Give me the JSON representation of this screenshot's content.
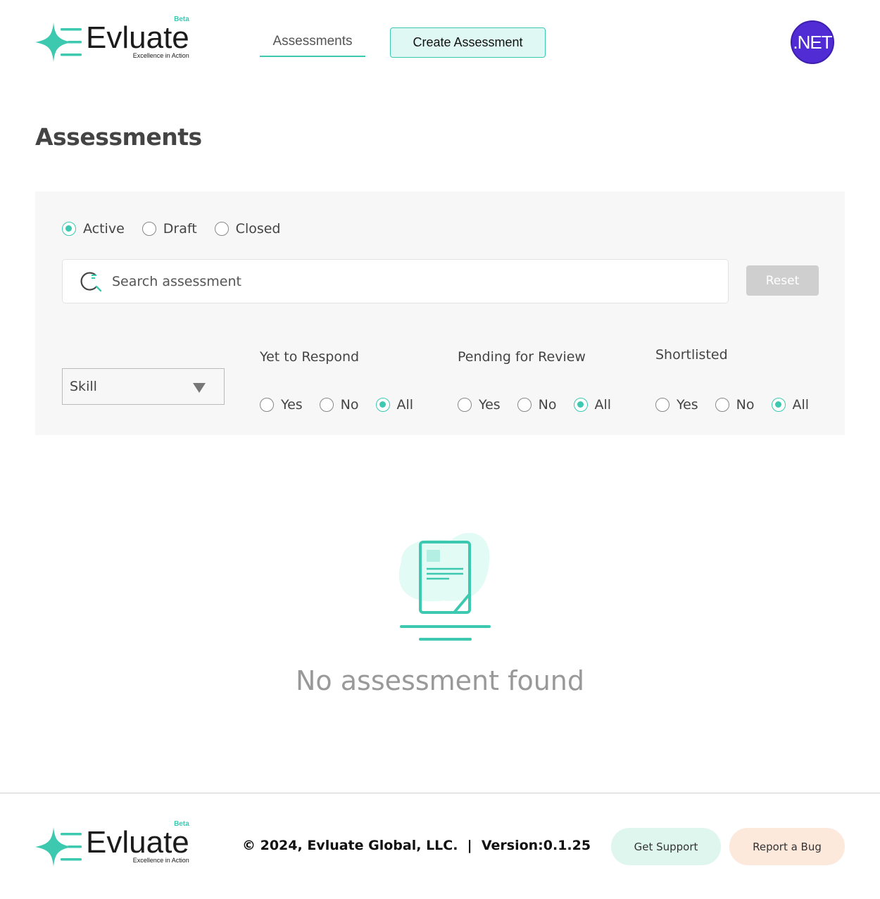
{
  "brand": {
    "name": "Evluate",
    "beta": "Beta",
    "tagline": "Excellence in Action",
    "accent_color": "#3cc9b0"
  },
  "header": {
    "nav_assessments": "Assessments",
    "create_assessment": "Create Assessment",
    "avatar_text": ".NET",
    "avatar_color": "#512bd4"
  },
  "page": {
    "title": "Assessments"
  },
  "filters": {
    "status": [
      {
        "label": "Active",
        "selected": true
      },
      {
        "label": "Draft",
        "selected": false
      },
      {
        "label": "Closed",
        "selected": false
      }
    ],
    "search": {
      "placeholder": "Search assessment",
      "value": ""
    },
    "reset_label": "Reset",
    "skill_label": "Skill",
    "groups": [
      {
        "title": "Yet to Respond",
        "options": [
          {
            "label": "Yes",
            "selected": false
          },
          {
            "label": "No",
            "selected": false
          },
          {
            "label": "All",
            "selected": true
          }
        ]
      },
      {
        "title": "Pending for Review",
        "options": [
          {
            "label": "Yes",
            "selected": false
          },
          {
            "label": "No",
            "selected": false
          },
          {
            "label": "All",
            "selected": true
          }
        ]
      },
      {
        "title": "Shortlisted",
        "options": [
          {
            "label": "Yes",
            "selected": false
          },
          {
            "label": "No",
            "selected": false
          },
          {
            "label": "All",
            "selected": true
          }
        ]
      }
    ]
  },
  "empty_state": {
    "message": "No assessment found"
  },
  "footer": {
    "copyright": "© 2024, Evluate Global, LLC.  |  Version:0.1.25",
    "get_support": "Get Support",
    "report_bug": "Report a Bug"
  }
}
